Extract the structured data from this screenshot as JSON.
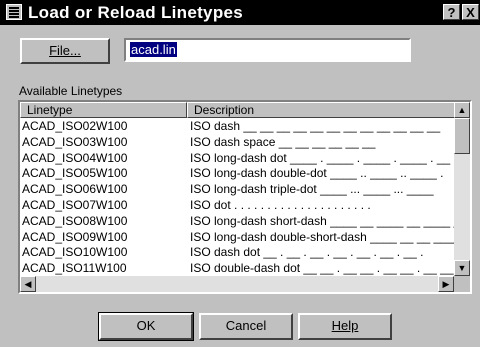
{
  "window": {
    "title": "Load or Reload Linetypes",
    "help_glyph": "?",
    "close_glyph": "X"
  },
  "file": {
    "button_label": "File...",
    "value": "acad.lin"
  },
  "list": {
    "section_label": "Available Linetypes",
    "columns": [
      "Linetype",
      "Description"
    ],
    "rows": [
      {
        "linetype": "ACAD_ISO02W100",
        "description": "ISO dash __ __ __ __ __ __ __ __ __ __ __ __"
      },
      {
        "linetype": "ACAD_ISO03W100",
        "description": "ISO dash space __    __    __    __    __    __"
      },
      {
        "linetype": "ACAD_ISO04W100",
        "description": "ISO long-dash dot ____ . ____ . ____ . ____ . __"
      },
      {
        "linetype": "ACAD_ISO05W100",
        "description": "ISO long-dash double-dot ____ .. ____ .. ____ ."
      },
      {
        "linetype": "ACAD_ISO06W100",
        "description": "ISO long-dash triple-dot ____ ... ____ ... ____"
      },
      {
        "linetype": "ACAD_ISO07W100",
        "description": "ISO dot . . . . . . . . . . . . . . . . . . . . ."
      },
      {
        "linetype": "ACAD_ISO08W100",
        "description": "ISO long-dash short-dash ____ __ ____ __ ____ _"
      },
      {
        "linetype": "ACAD_ISO09W100",
        "description": "ISO long-dash double-short-dash ____ __ __ ____"
      },
      {
        "linetype": "ACAD_ISO10W100",
        "description": "ISO dash dot __ . __ . __ . __ . __ . __ . __ ."
      },
      {
        "linetype": "ACAD_ISO11W100",
        "description": "ISO double-dash dot __ __ . __ __ . __ __ . __ __"
      }
    ]
  },
  "buttons": {
    "ok": "OK",
    "cancel": "Cancel",
    "help": "Help"
  },
  "scroll_arrows": {
    "up": "▲",
    "down": "▼",
    "left": "◀",
    "right": "▶"
  }
}
